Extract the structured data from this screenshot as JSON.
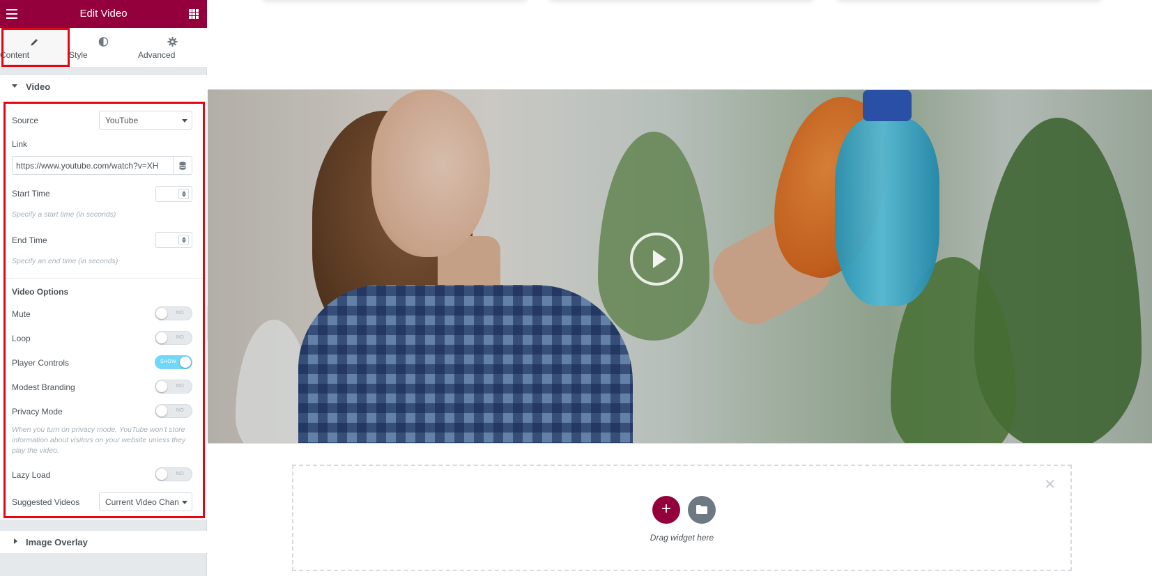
{
  "header": {
    "title": "Edit Video"
  },
  "tabs": [
    {
      "label": "Content",
      "icon": "pencil-icon",
      "active": true
    },
    {
      "label": "Style",
      "icon": "half-circle-icon",
      "active": false
    },
    {
      "label": "Advanced",
      "icon": "gear-icon",
      "active": false
    }
  ],
  "video_section": {
    "title": "Video",
    "source": {
      "label": "Source",
      "value": "YouTube"
    },
    "link": {
      "label": "Link",
      "value": "https://www.youtube.com/watch?v=XH"
    },
    "start_time": {
      "label": "Start Time",
      "hint": "Specify a start time (in seconds)"
    },
    "end_time": {
      "label": "End Time",
      "hint": "Specify an end time (in seconds)"
    },
    "options_title": "Video Options",
    "mute": {
      "label": "Mute",
      "state": "NO"
    },
    "loop": {
      "label": "Loop",
      "state": "NO"
    },
    "player_controls": {
      "label": "Player Controls",
      "state": "SHOW"
    },
    "modest_branding": {
      "label": "Modest Branding",
      "state": "NO"
    },
    "privacy_mode": {
      "label": "Privacy Mode",
      "state": "NO",
      "hint": "When you turn on privacy mode, YouTube won't store information about visitors on your website unless they play the video."
    },
    "lazy_load": {
      "label": "Lazy Load",
      "state": "NO"
    },
    "suggested_videos": {
      "label": "Suggested Videos",
      "value": "Current Video Chan"
    }
  },
  "image_overlay": {
    "title": "Image Overlay"
  },
  "drop_zone": {
    "text": "Drag widget here",
    "add_symbol": "+",
    "close_symbol": "✕"
  },
  "colors": {
    "brand": "#93003c",
    "switch_on": "#71d7f7",
    "highlight": "#e30613"
  }
}
